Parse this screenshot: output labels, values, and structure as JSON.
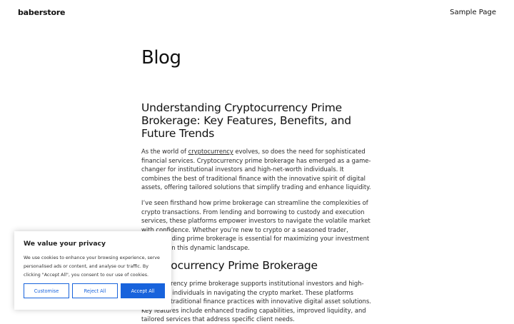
{
  "header": {
    "site_title": "baberstore",
    "nav": [
      {
        "label": "Sample Page"
      }
    ]
  },
  "page": {
    "title": "Blog"
  },
  "post": {
    "title": "Understanding Cryptocurrency Prime Brokerage: Key Features, Benefits, and Future Trends",
    "p1_before": "As the world of ",
    "p1_link": "cryptocurrency",
    "p1_after": " evolves, so does the need for sophisticated financial services. Cryptocurrency prime brokerage has emerged as a game-changer for institutional investors and high-net-worth individuals. It combines the best of traditional finance with the innovative spirit of digital assets, offering tailored solutions that simplify trading and enhance liquidity.",
    "p2": "I’ve seen firsthand how prime brokerage can streamline the complexities of crypto transactions. From lending and borrowing to custody and execution services, these platforms empower investors to navigate the volatile market with confidence. Whether you’re new to crypto or a seasoned trader, understanding prime brokerage is essential for maximizing your investment potential in this dynamic landscape.",
    "section_heading": "Cryptocurrency Prime Brokerage",
    "p3": "Cryptocurrency prime brokerage supports institutional investors and high-net-worth individuals in navigating the crypto market. These platforms integrate traditional finance practices with innovative digital asset solutions. Key features include enhanced trading capabilities, improved liquidity, and tailored services that address specific client needs."
  },
  "cookie_banner": {
    "title": "We value your privacy",
    "text": "We use cookies to enhance your browsing experience, serve personalised ads or content, and analyse our traffic. By clicking \"Accept All\", you consent to our use of cookies.",
    "customise_label": "Customise",
    "reject_label": "Reject All",
    "accept_label": "Accept All",
    "accent_color": "#1863dc"
  }
}
